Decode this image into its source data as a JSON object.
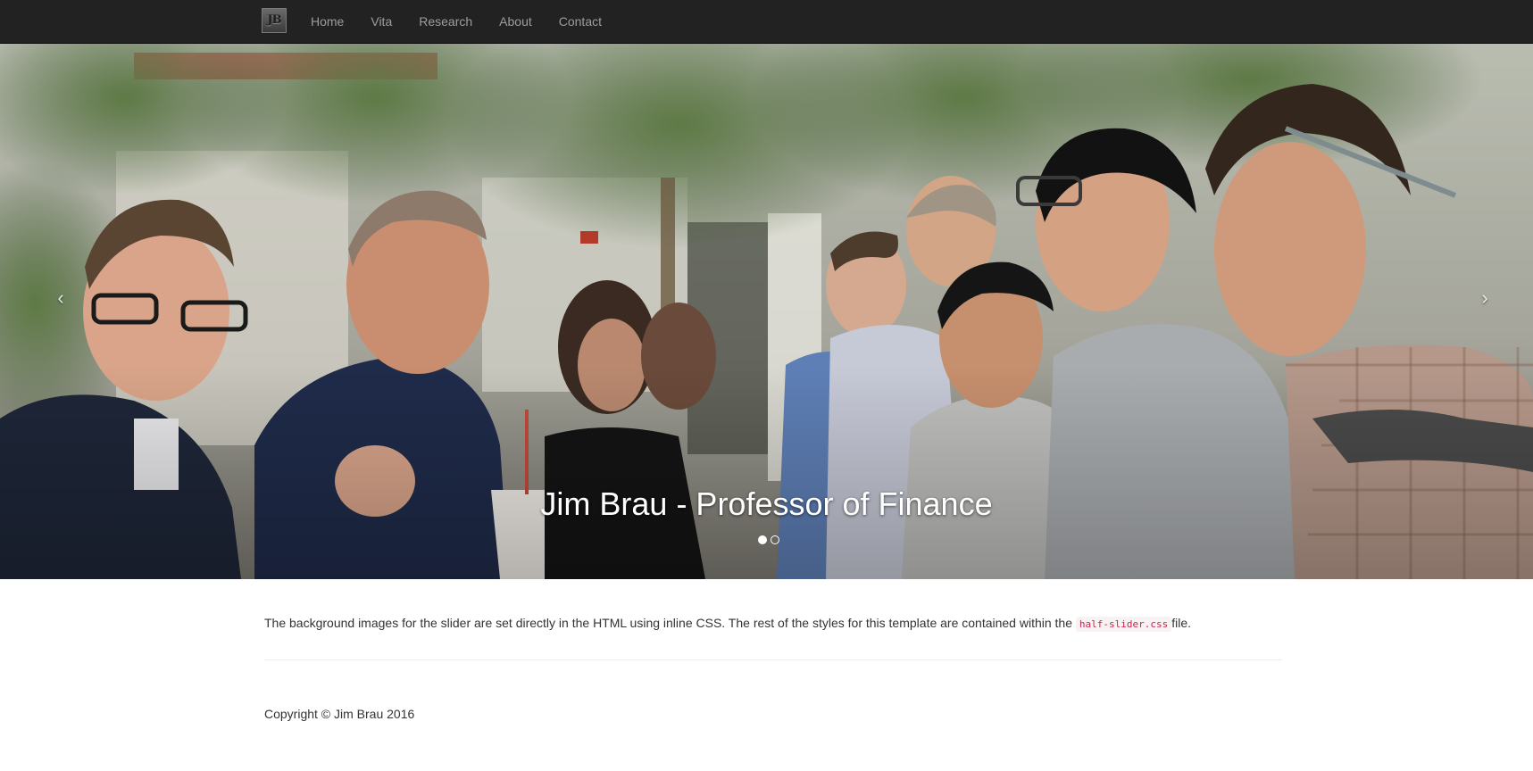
{
  "navbar": {
    "brand": "JB",
    "items": [
      {
        "label": "Home"
      },
      {
        "label": "Vita"
      },
      {
        "label": "Research"
      },
      {
        "label": "About"
      },
      {
        "label": "Contact"
      }
    ]
  },
  "hero": {
    "caption": "Jim Brau - Professor of Finance",
    "prev_glyph": "‹",
    "next_glyph": "›",
    "indicator_count": 2,
    "active_indicator": 1
  },
  "content": {
    "text_before": "The background images for the slider are set directly in the HTML using inline CSS. The rest of the styles for this template are contained within the",
    "code": "half-slider.css",
    "text_after": "file."
  },
  "footer": {
    "copyright": "Copyright © Jim Brau 2016"
  }
}
